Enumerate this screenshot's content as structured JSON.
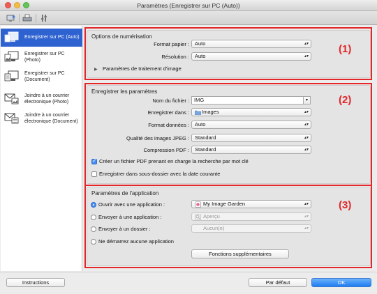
{
  "window": {
    "title": "Paramètres (Enregistrer sur PC (Auto))"
  },
  "sidebar": {
    "items": [
      {
        "label": "Enregistrer sur PC (Auto)",
        "icon": "save-to-pc-auto-icon"
      },
      {
        "label": "Enregistrer sur PC (Photo)",
        "icon": "save-to-pc-photo-icon"
      },
      {
        "label": "Enregistrer sur PC (Document)",
        "icon": "save-to-pc-document-icon"
      },
      {
        "label": "Joindre à un courrier électronique (Photo)",
        "icon": "email-photo-icon"
      },
      {
        "label": "Joindre à un courrier électronique (Document)",
        "icon": "email-document-icon"
      }
    ]
  },
  "scan_options": {
    "title": "Options de numérisation",
    "paper_size_label": "Format papier :",
    "paper_size_value": "Auto",
    "resolution_label": "Résolution :",
    "resolution_value": "Auto",
    "image_processing_label": "Paramètres de traitement d'image",
    "marker": "(1)"
  },
  "save_settings": {
    "title": "Enregistrer les paramètres",
    "file_name_label": "Nom du fichier :",
    "file_name_value": "IMG",
    "save_in_label": "Enregistrer dans :",
    "save_in_value": "Images",
    "data_format_label": "Format données :",
    "data_format_value": "Auto",
    "jpeg_quality_label": "Qualité des images JPEG :",
    "jpeg_quality_value": "Standard",
    "pdf_compression_label": "Compression PDF :",
    "pdf_compression_value": "Standard",
    "searchable_pdf_label": "Créer un fichier PDF prenant en charge la recherche par mot clé",
    "searchable_pdf_checked": true,
    "subfolder_label": "Enregistrer dans sous-dossier avec la date courante",
    "subfolder_checked": false,
    "marker": "(2)"
  },
  "app_settings": {
    "title": "Paramètres de l'application",
    "open_app_label": "Ouvrir avec une application :",
    "open_app_value": "My Image Garden",
    "send_app_label": "Envoyer à une application :",
    "send_app_value": "Aperçu",
    "send_folder_label": "Envoyer à un dossier :",
    "send_folder_value": "Aucun(e)",
    "no_app_label": "Ne démarrez aucune application",
    "more_functions_label": "Fonctions supplémentaires",
    "marker": "(3)"
  },
  "footer": {
    "instructions_label": "Instructions",
    "default_label": "Par défaut",
    "ok_label": "OK"
  },
  "colors": {
    "accent": "#2e62d0",
    "marker": "#e2262a",
    "ok_button": "#1e7cf2"
  }
}
